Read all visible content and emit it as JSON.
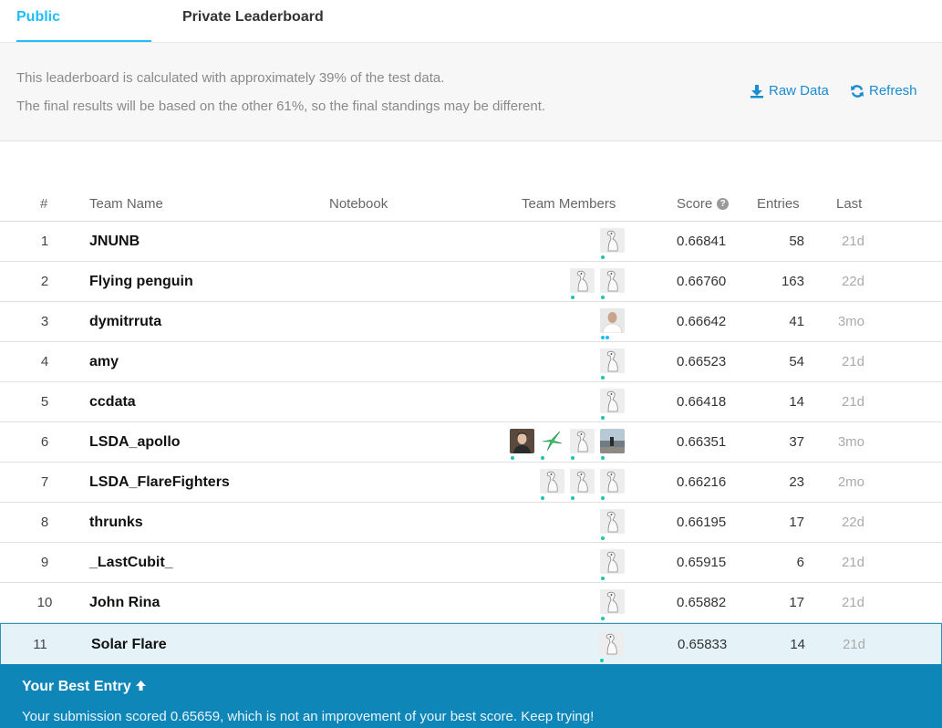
{
  "tabs": {
    "public": "Public Leaderboard",
    "private": "Private Leaderboard"
  },
  "info": {
    "line1": "This leaderboard is calculated with approximately 39% of the test data.",
    "line2": "The final results will be based on the other 61%, so the final standings may be different.",
    "raw_data": "Raw Data",
    "refresh": "Refresh"
  },
  "table": {
    "headers": {
      "rank": "#",
      "team": "Team Name",
      "notebook": "Notebook",
      "members": "Team Members",
      "score": "Score",
      "entries": "Entries",
      "last": "Last"
    },
    "rows": [
      {
        "rank": "1",
        "team": "JNUNB",
        "score": "0.66841",
        "entries": "58",
        "last": "21d",
        "avatars": [
          "goose"
        ]
      },
      {
        "rank": "2",
        "team": "Flying penguin",
        "score": "0.66760",
        "entries": "163",
        "last": "22d",
        "avatars": [
          "goose",
          "goose"
        ]
      },
      {
        "rank": "3",
        "team": "dymitrruta",
        "score": "0.66642",
        "entries": "41",
        "last": "3mo",
        "avatars": [
          "person-man"
        ]
      },
      {
        "rank": "4",
        "team": "amy",
        "score": "0.66523",
        "entries": "54",
        "last": "21d",
        "avatars": [
          "goose"
        ]
      },
      {
        "rank": "5",
        "team": "ccdata",
        "score": "0.66418",
        "entries": "14",
        "last": "21d",
        "avatars": [
          "goose"
        ]
      },
      {
        "rank": "6",
        "team": "LSDA_apollo",
        "score": "0.66351",
        "entries": "37",
        "last": "3mo",
        "avatars": [
          "person-woman",
          "green-star",
          "goose",
          "landscape"
        ]
      },
      {
        "rank": "7",
        "team": "LSDA_FlareFighters",
        "score": "0.66216",
        "entries": "23",
        "last": "2mo",
        "avatars": [
          "goose",
          "goose",
          "goose"
        ]
      },
      {
        "rank": "8",
        "team": "thrunks",
        "score": "0.66195",
        "entries": "17",
        "last": "22d",
        "avatars": [
          "goose"
        ]
      },
      {
        "rank": "9",
        "team": "_LastCubit_",
        "score": "0.65915",
        "entries": "6",
        "last": "21d",
        "avatars": [
          "goose"
        ]
      },
      {
        "rank": "10",
        "team": "John Rina",
        "score": "0.65882",
        "entries": "17",
        "last": "21d",
        "avatars": [
          "goose"
        ]
      },
      {
        "rank": "11",
        "team": "Solar Flare",
        "score": "0.65833",
        "entries": "14",
        "last": "21d",
        "avatars": [
          "goose"
        ],
        "highlight": true
      }
    ]
  },
  "best_entry": {
    "title": "Your Best Entry",
    "message": "Your submission scored 0.65659, which is not an improvement of your best score. Keep trying!"
  },
  "colors": {
    "accent": "#20beff",
    "link": "#1a8cd0",
    "banner": "#0f86b8",
    "status_dot": "#20c4aa"
  }
}
